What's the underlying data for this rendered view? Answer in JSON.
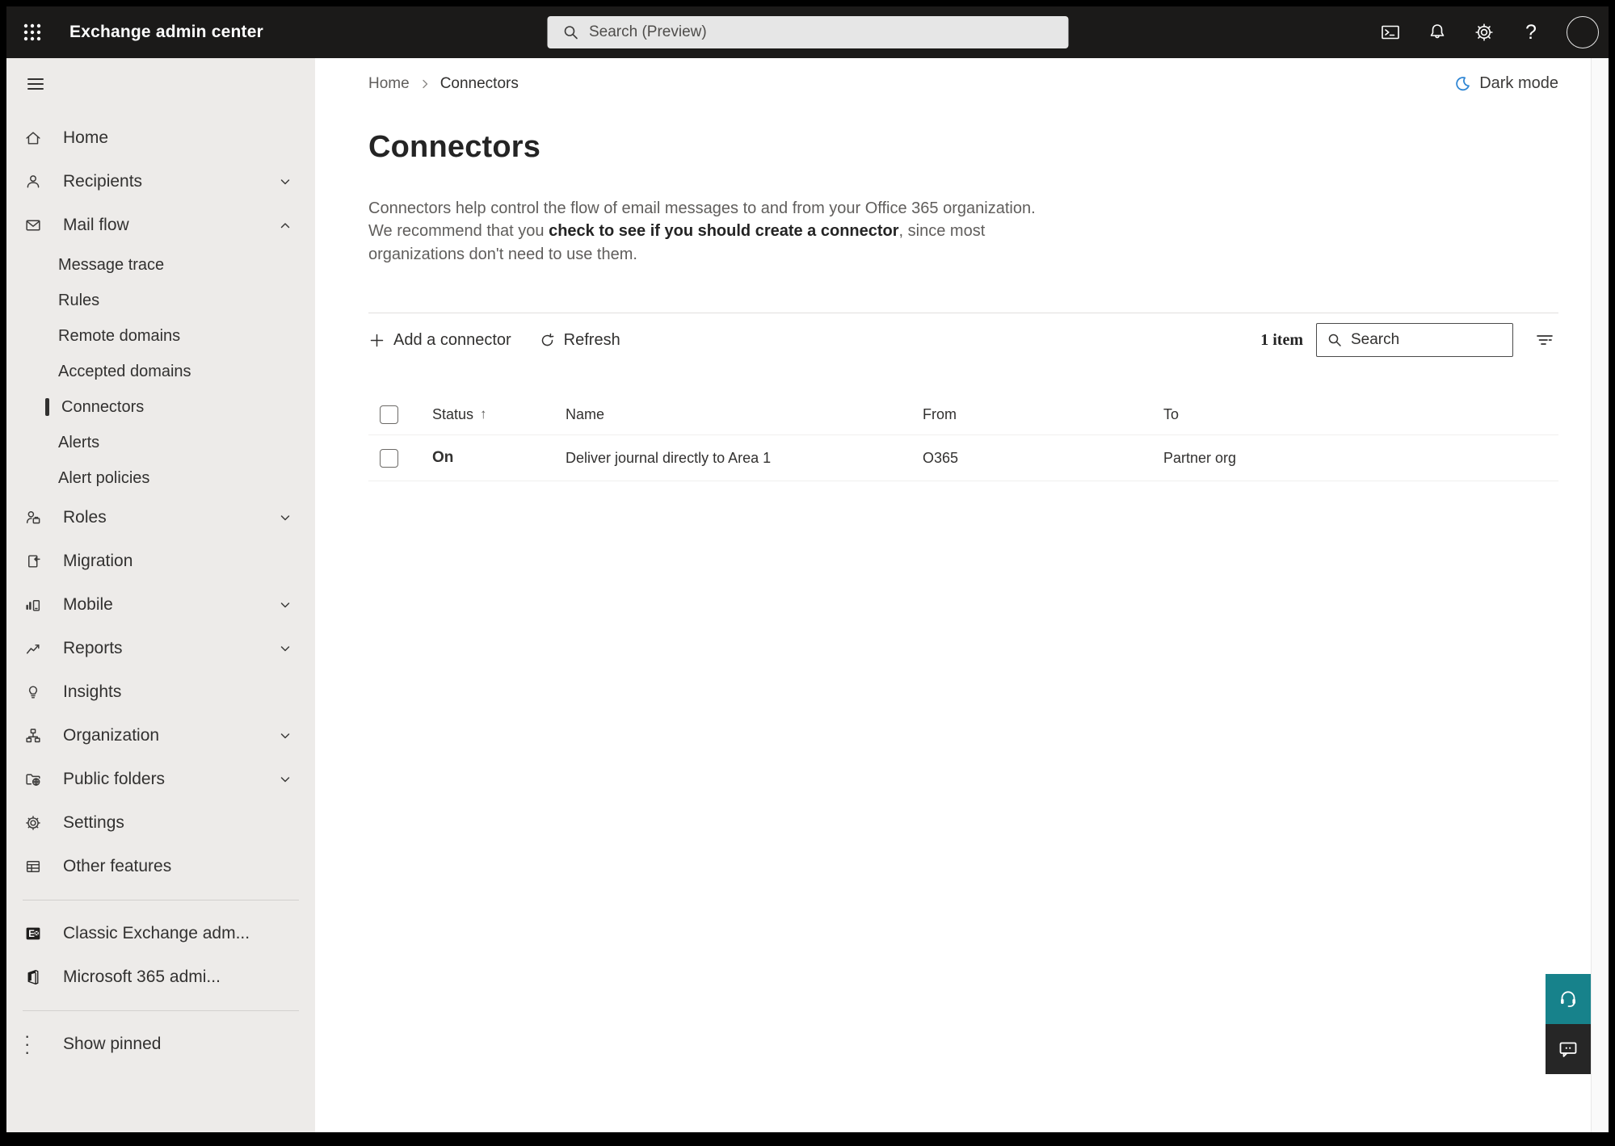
{
  "topbar": {
    "title": "Exchange admin center",
    "search_placeholder": "Search (Preview)"
  },
  "breadcrumb": {
    "home": "Home",
    "current": "Connectors"
  },
  "header": {
    "dark_mode_label": "Dark mode"
  },
  "page": {
    "title": "Connectors",
    "desc_pre": "Connectors help control the flow of email messages to and from your Office 365 organization. We recommend that you ",
    "desc_strong": "check to see if you should create a connector",
    "desc_post": ", since most organizations don't need to use them."
  },
  "toolbar": {
    "add_label": "Add a connector",
    "refresh_label": "Refresh",
    "item_count": "1 item",
    "search_placeholder": "Search"
  },
  "table": {
    "col_status": "Status",
    "sort_arrow": "↑",
    "col_name": "Name",
    "col_from": "From",
    "col_to": "To",
    "rows": [
      {
        "status": "On",
        "name": "Deliver journal directly to Area 1",
        "from": "O365",
        "to": "Partner org"
      }
    ]
  },
  "sidebar": {
    "home": "Home",
    "recipients": "Recipients",
    "mail_flow": "Mail flow",
    "message_trace": "Message trace",
    "rules": "Rules",
    "remote_domains": "Remote domains",
    "accepted_domains": "Accepted domains",
    "connectors": "Connectors",
    "alerts": "Alerts",
    "alert_policies": "Alert policies",
    "roles": "Roles",
    "migration": "Migration",
    "mobile": "Mobile",
    "reports": "Reports",
    "insights": "Insights",
    "organization": "Organization",
    "public_folders": "Public folders",
    "settings": "Settings",
    "other_features": "Other features",
    "classic_exchange": "Classic Exchange adm...",
    "m365_admin": "Microsoft 365 admi...",
    "show_pinned": "Show pinned"
  },
  "glyphs": {
    "help": "?",
    "ellipsis": "· · ·",
    "breadcrumb_e_logo": "E"
  },
  "colors": {
    "topbar_bg": "#1b1a19",
    "sidebar_bg": "#edebe9",
    "accent_teal": "#17828b",
    "feedback_dark": "#262626",
    "dark_mode_blue": "#2f86d4",
    "text_primary": "#323130",
    "text_secondary": "#605e5c"
  }
}
